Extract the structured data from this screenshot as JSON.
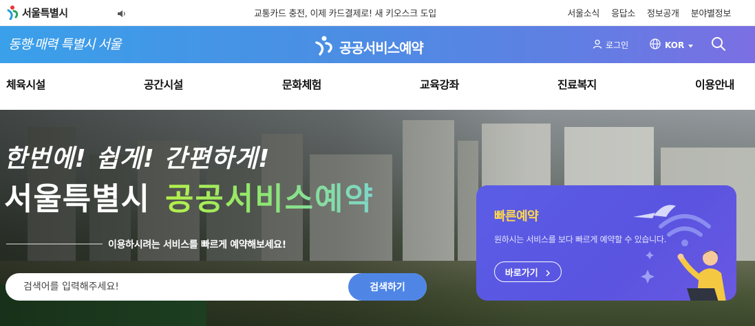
{
  "topbar": {
    "logo_text": "서울특별시",
    "notice": "교통카드 충전, 이제 카드결제로! 새 키오스크 도입",
    "links": [
      "서울소식",
      "응답소",
      "정보공개",
      "분야별정보"
    ]
  },
  "header": {
    "slogan": "동행·매력 특별시 서울",
    "brand": "공공서비스예약",
    "login_label": "로그인",
    "language": "KOR",
    "gradient_colors": [
      "#3aa0ea",
      "#7b6fe3"
    ]
  },
  "nav": {
    "items": [
      "체육시설",
      "공간시설",
      "문화체험",
      "교육강좌",
      "진료복지",
      "이용안내"
    ]
  },
  "hero": {
    "line1": "한번에! 쉽게! 간편하게!",
    "line2_white": "서울특별시",
    "line2_accent": "공공서비스예약",
    "subtitle": "이용하시려는 서비스를 빠르게 예약해보세요!",
    "search": {
      "placeholder": "검색어를 입력해주세요!",
      "value": "",
      "button_label": "검색하기"
    },
    "accent_color": "#4f86e6"
  },
  "quick_card": {
    "title": "빠른예약",
    "description": "원하시는 서비스를 보다 빠르게 예약할 수 있습니다.",
    "button_label": "바로가기",
    "title_color": "#ffd84a",
    "background_color": "#5b5de6"
  }
}
